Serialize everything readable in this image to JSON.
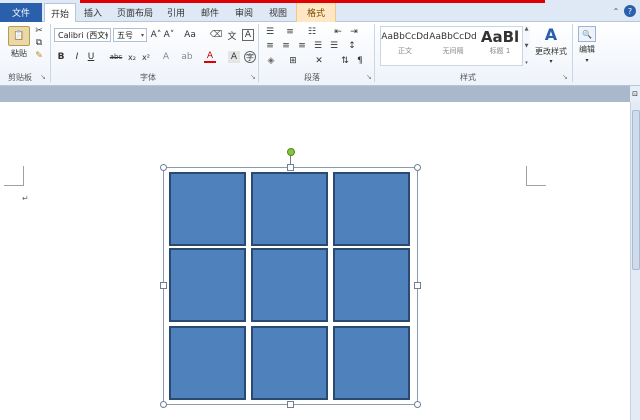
{
  "tabs": {
    "file": "文件",
    "items": [
      "开始",
      "插入",
      "页面布局",
      "引用",
      "邮件",
      "审阅",
      "视图",
      "格式"
    ],
    "active": "开始"
  },
  "clipboard": {
    "paste": "粘贴",
    "group": "剪贴板"
  },
  "font": {
    "name": "Calibri (西文)",
    "size": "五号",
    "group": "字体",
    "grow_icon": "A˄",
    "shrink_icon": "A˅",
    "case_icon": "Aa",
    "bold": "B",
    "italic": "I",
    "underline": "U",
    "strike": "abc",
    "subscript": "x₂",
    "superscript": "x²",
    "color_icon": "A"
  },
  "paragraph": {
    "group": "段落"
  },
  "styles": {
    "group": "样式",
    "items": [
      {
        "sample": "AaBbCcDd",
        "name": "正文"
      },
      {
        "sample": "AaBbCcDd",
        "name": "无间隔"
      },
      {
        "sample": "AaBl",
        "name": "标题 1"
      }
    ],
    "change": "更改样式"
  },
  "editing": {
    "label": "编辑"
  },
  "colors": {
    "accent": "#2a5fab",
    "shape_fill": "#4f81bd",
    "shape_border": "#2b4a6f",
    "rotate_handle": "#86c440",
    "top_bar": "#e00000"
  }
}
